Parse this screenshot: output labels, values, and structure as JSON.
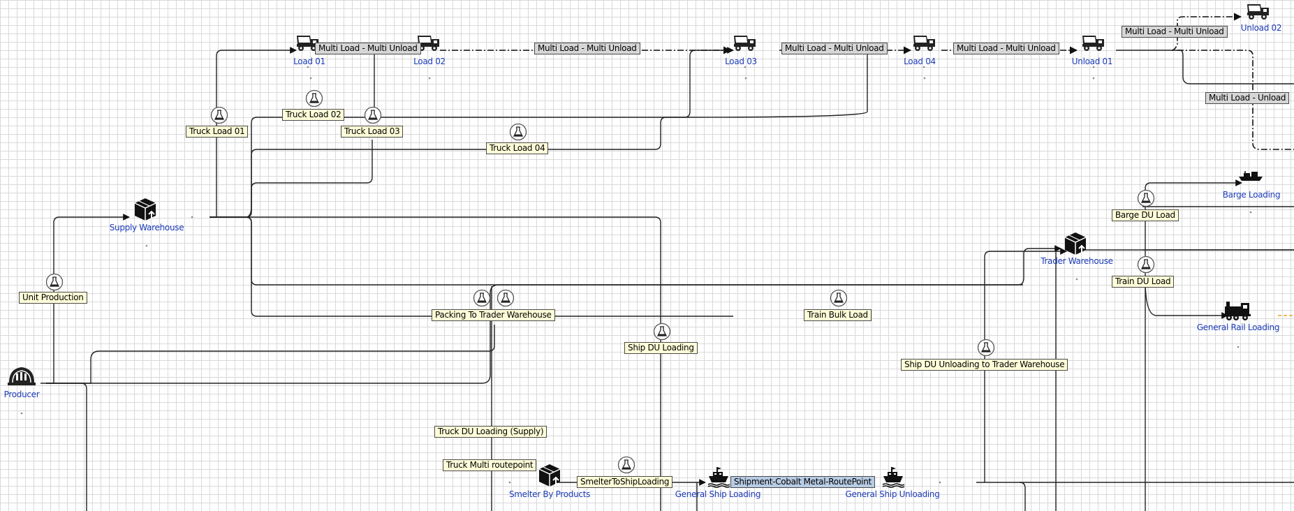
{
  "nodes": {
    "producer": {
      "name": "Producer",
      "icon": "factory-icon"
    },
    "supply_warehouse": {
      "name": "Supply Warehouse",
      "icon": "warehouse-icon"
    },
    "load_01": {
      "name": "Load 01",
      "icon": "dump-truck-icon"
    },
    "load_02": {
      "name": "Load 02",
      "icon": "dump-truck-icon"
    },
    "load_03": {
      "name": "Load 03",
      "icon": "dump-truck-icon"
    },
    "load_04": {
      "name": "Load 04",
      "icon": "dump-truck-icon"
    },
    "unload_01": {
      "name": "Unload 01",
      "icon": "dump-truck-icon"
    },
    "unload_02": {
      "name": "Unload 02",
      "icon": "dump-truck-icon"
    },
    "barge_loading": {
      "name": "Barge Loading",
      "icon": "barge-icon"
    },
    "trader_warehouse": {
      "name": "Trader Warehouse",
      "icon": "warehouse-icon"
    },
    "general_rail_loading": {
      "name": "General Rail Loading",
      "icon": "train-icon"
    },
    "smelter_by_products": {
      "name": "Smelter By Products",
      "icon": "warehouse-icon"
    },
    "general_ship_loading": {
      "name": "General Ship Loading",
      "icon": "ship-icon"
    },
    "general_ship_unloading": {
      "name": "General Ship Unloading",
      "icon": "ship-icon"
    }
  },
  "route_labels": {
    "unit_production": "Unit Production",
    "truck_load_01": "Truck Load 01",
    "truck_load_02": "Truck Load 02",
    "truck_load_03": "Truck Load 03",
    "truck_load_04": "Truck Load 04",
    "packing_to_trader_warehouse": "Packing To Trader Warehouse",
    "train_bulk_load": "Train Bulk Load",
    "ship_du_loading": "Ship DU Loading",
    "ship_du_unloading_to_trader_warehouse": "Ship DU Unloading to Trader Warehouse",
    "barge_du_load": "Barge DU Load",
    "train_du_load": "Train DU Load",
    "truck_du_loading_supply": "Truck DU Loading (Supply)",
    "truck_multi_routepoint": "Truck Multi routepoint",
    "smelter_to_ship_loading": "SmelterToShipLoading"
  },
  "multi_labels": {
    "ml_1": "Multi Load - Multi Unload",
    "ml_2": "Multi Load - Multi Unload",
    "ml_3": "Multi Load - Multi Unload",
    "ml_4": "Multi Load - Multi Unload",
    "ml_5": "Multi Load - Multi Unload",
    "ml_unload": "Multi Load - Unload"
  },
  "shipment_label": "Shipment-Cobalt Metal-RoutePoint",
  "colors": {
    "node_name": "#1c3bb8",
    "label_yellow": "#fffdd8",
    "label_gray": "#d6d6d6",
    "label_blue": "#b7cbe3",
    "connector": "#222222",
    "accent_orange": "#e8a21a"
  }
}
